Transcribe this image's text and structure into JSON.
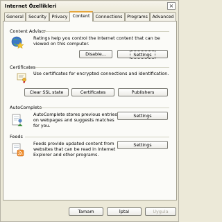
{
  "window": {
    "title": "Internet Özellikleri",
    "close_glyph": "×"
  },
  "tabs": [
    {
      "label": "General",
      "active": false
    },
    {
      "label": "Security",
      "active": false
    },
    {
      "label": "Privacy",
      "active": false
    },
    {
      "label": "Content",
      "active": true
    },
    {
      "label": "Connections",
      "active": false
    },
    {
      "label": "Programs",
      "active": false
    },
    {
      "label": "Advanced",
      "active": false
    }
  ],
  "content_advisor": {
    "label": "Content Advisor",
    "description_line1": "Ratings help you control the Internet content that can be",
    "description_line2": "viewed on this computer.",
    "enable_button": "Disable...",
    "settings_button": "Settings"
  },
  "certificates": {
    "label": "Certificates",
    "description": "Use certificates for encrypted connections and identification.",
    "clear_ssl_button": "Clear SSL state",
    "certificates_button": "Certificates",
    "publishers_button": "Publishers"
  },
  "autocomplete": {
    "label": "AutoComplete",
    "description_line1": "AutoComplete stores previous entries",
    "description_line2": "on webpages and suggests matches",
    "description_line3": "for you.",
    "settings_button": "Settings"
  },
  "feeds": {
    "label": "Feeds",
    "description_line1": "Feeds provide updated content from",
    "description_line2": "websites that can be read in Internet",
    "description_line3": "Explorer and other programs.",
    "settings_button": "Settings"
  },
  "footer": {
    "ok_button": "Tamam",
    "cancel_button": "İptal",
    "apply_button": "Uygula"
  },
  "colors": {
    "window_bg": "#ece9d8",
    "panel_bg": "#fbfbf8",
    "active_tab_accent": "#e6a53a",
    "separator": "#d0d0bf"
  }
}
